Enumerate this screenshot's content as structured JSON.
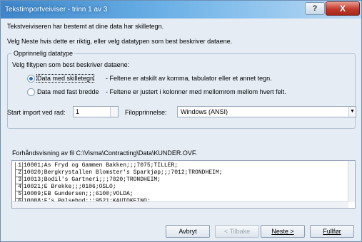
{
  "window": {
    "title": "Tekstimportveiviser - trinn 1 av 3",
    "help_label": "?",
    "close_label": "X"
  },
  "intro": {
    "line1": "Tekstveiviseren har bestemt at dine data har skilletegn.",
    "line2": "Velg Neste hvis dette er riktig, eller velg datatypen som best beskriver dataene."
  },
  "group": {
    "legend": "Opprinnelig datatype",
    "prompt": "Velg filtypen som best beskriver dataene:",
    "options": [
      {
        "label": "Data med skilletegn",
        "desc": "- Feltene er atskilt av komma, tabulator eller et annet tegn.",
        "selected": true
      },
      {
        "label": "Data med fast bredde",
        "desc": "- Feltene er justert i kolonner med mellomrom mellom hvert felt.",
        "selected": false
      }
    ]
  },
  "start": {
    "label": "Start import ved rad:",
    "value": "1"
  },
  "origin": {
    "label": "Filopprinnelse:",
    "value": "Windows (ANSI)"
  },
  "preview": {
    "label": "Forhåndsvisning av fil C:\\Visma\\Contracting\\Data\\KUNDER.OVF.",
    "lines": [
      {
        "num": "1",
        "text": "10001;As Fryd og Gammen Bakken;;;7075;TILLER;"
      },
      {
        "num": "2",
        "text": "10020;Bergkrystallen Blomster's Sparkjøp;;;7012;TRONDHEIM;"
      },
      {
        "num": "3",
        "text": "10013;Bodil's Gartneri;;;7020;TRONDHEIM;"
      },
      {
        "num": "4",
        "text": "10021;E Brekke;;;0106;OSLO;"
      },
      {
        "num": "5",
        "text": "10009;EB Gundersen;;;6100;VOLDA;"
      },
      {
        "num": "6",
        "text": "10008;F's Pølsebod;;;9521;KAUTOKEINO;"
      }
    ]
  },
  "buttons": {
    "cancel": "Avbryt",
    "back": "< Tilbake",
    "next": "Neste >",
    "finish": "Fullfør"
  }
}
